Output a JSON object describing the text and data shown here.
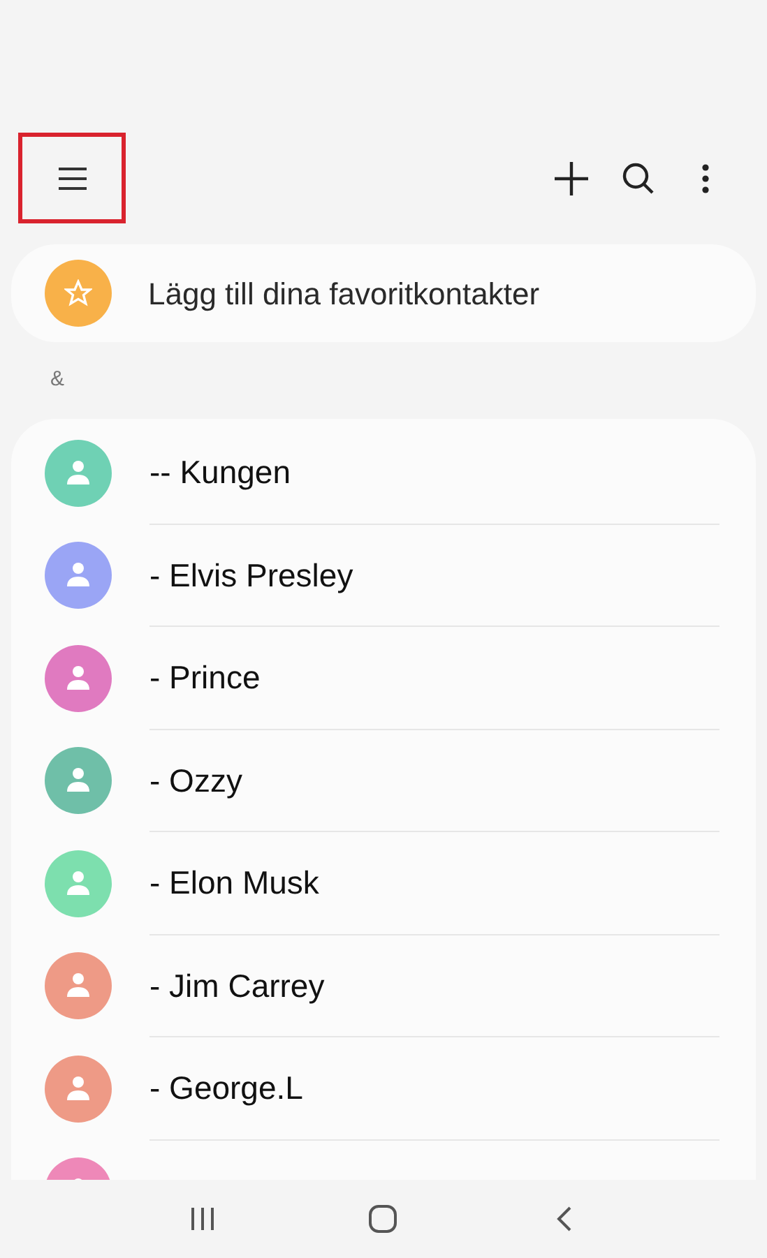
{
  "toolbar": {
    "menu": {
      "highlighted": true
    },
    "actions": [
      {
        "kind": "add"
      },
      {
        "kind": "search"
      },
      {
        "kind": "more"
      }
    ]
  },
  "favorites": {
    "label": "Lägg till dina favoritkontakter"
  },
  "section": "&",
  "contacts": [
    {
      "name": "-- Kungen",
      "color": "#6fd1b4"
    },
    {
      "name": "- Elvis Presley",
      "color": "#9aa5f5"
    },
    {
      "name": "- Prince",
      "color": "#e07ac0"
    },
    {
      "name": "- Ozzy",
      "color": "#6fbfa8"
    },
    {
      "name": "- Elon Musk",
      "color": "#7ddfae"
    },
    {
      "name": "- Jim Carrey",
      "color": "#ee9a86"
    },
    {
      "name": "- George.L",
      "color": "#ee9a86"
    }
  ],
  "partial_contact": {
    "color": "#ee88b8"
  }
}
